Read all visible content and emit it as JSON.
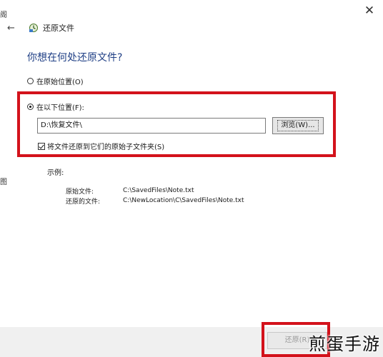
{
  "window": {
    "title": "还原文件",
    "close_glyph": "✕",
    "left_clip_top": "阁",
    "left_clip_mid": "图"
  },
  "heading": "你想在何处还原文件?",
  "options": {
    "original_location": "在原始位置(O)",
    "following_location": "在以下位置(F):"
  },
  "path": {
    "value": "D:\\恢复文件\\"
  },
  "browse_label": "浏览(W)...",
  "subfolder_checkbox": {
    "label": "将文件还原到它们的原始子文件夹(S)",
    "checked": true
  },
  "example": {
    "label": "示例:",
    "rows": [
      {
        "key": "原始文件:",
        "value": "C:\\SavedFiles\\Note.txt"
      },
      {
        "key": "还原的文件:",
        "value": "C:\\NewLocation\\C\\SavedFiles\\Note.txt"
      }
    ]
  },
  "restore_label": "还原(R)",
  "watermark": "煎蛋手游",
  "colors": {
    "heading": "#1f3f85",
    "highlight": "#d3121b"
  }
}
